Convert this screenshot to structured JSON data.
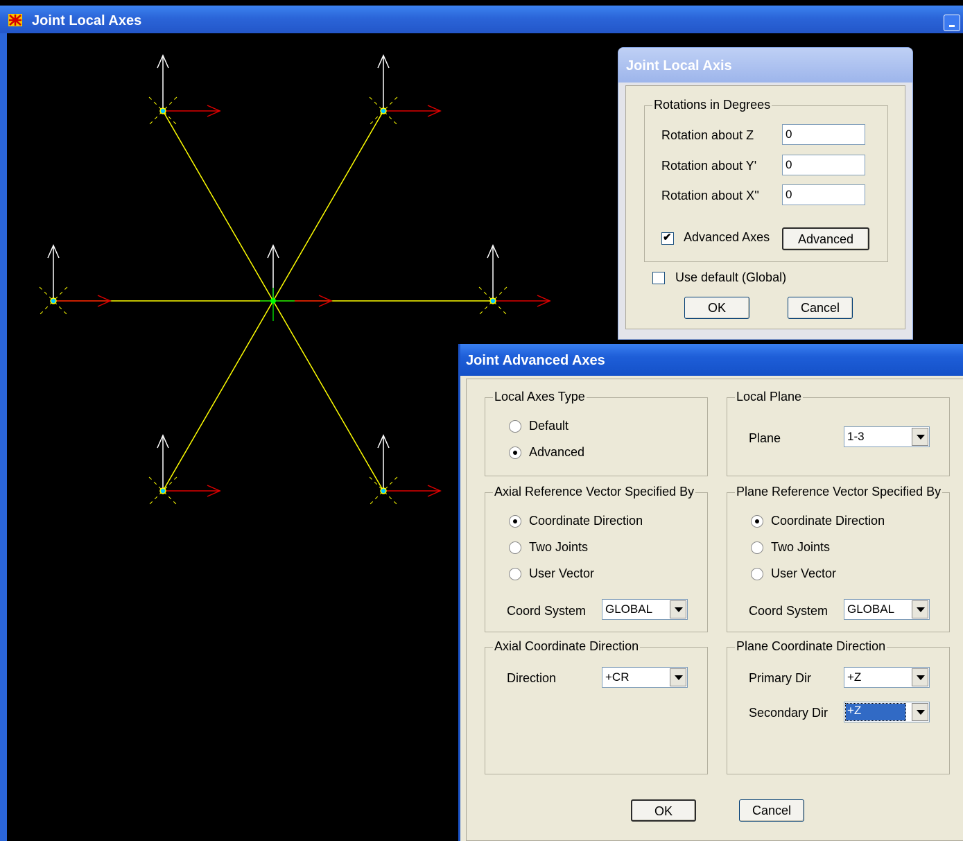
{
  "window": {
    "title": "Joint Local Axes"
  },
  "joint_local_axis": {
    "title": "Joint Local Axis",
    "group_rotations": "Rotations in Degrees",
    "rot_z_label": "Rotation about  Z",
    "rot_z_value": "0",
    "rot_y_label": "Rotation about  Y'",
    "rot_y_value": "0",
    "rot_x_label": "Rotation about  X''",
    "rot_x_value": "0",
    "advanced_axes_label": "Advanced Axes",
    "advanced_axes_checked": true,
    "advanced_button": "Advanced",
    "use_default_label": "Use default  (Global)",
    "use_default_checked": false,
    "ok": "OK",
    "cancel": "Cancel"
  },
  "joint_advanced_axes": {
    "title": "Joint Advanced Axes",
    "local_axes_type": {
      "legend": "Local Axes Type",
      "options": [
        "Default",
        "Advanced"
      ],
      "selected": "Advanced"
    },
    "local_plane": {
      "legend": "Local Plane",
      "plane_label": "Plane",
      "plane_value": "1-3"
    },
    "axial_ref": {
      "legend": "Axial Reference Vector Specified By",
      "options": [
        "Coordinate Direction",
        "Two Joints",
        "User Vector"
      ],
      "selected": "Coordinate Direction",
      "coord_system_label": "Coord System",
      "coord_system_value": "GLOBAL"
    },
    "plane_ref": {
      "legend": "Plane Reference Vector Specified By",
      "options": [
        "Coordinate Direction",
        "Two Joints",
        "User Vector"
      ],
      "selected": "Coordinate Direction",
      "coord_system_label": "Coord System",
      "coord_system_value": "GLOBAL"
    },
    "axial_dir": {
      "legend": "Axial Coordinate Direction",
      "direction_label": "Direction",
      "direction_value": "+CR"
    },
    "plane_dir": {
      "legend": "Plane Coordinate Direction",
      "primary_label": "Primary Dir",
      "primary_value": "+Z",
      "secondary_label": "Secondary Dir",
      "secondary_value": "+Z"
    },
    "ok": "OK",
    "cancel": "Cancel"
  },
  "colors": {
    "title_blue": "#2b65d8",
    "frame_yellow": "#ffff00",
    "axis_red": "#e00000",
    "axis_white": "#ffffff",
    "joint_green": "#00ff00"
  }
}
